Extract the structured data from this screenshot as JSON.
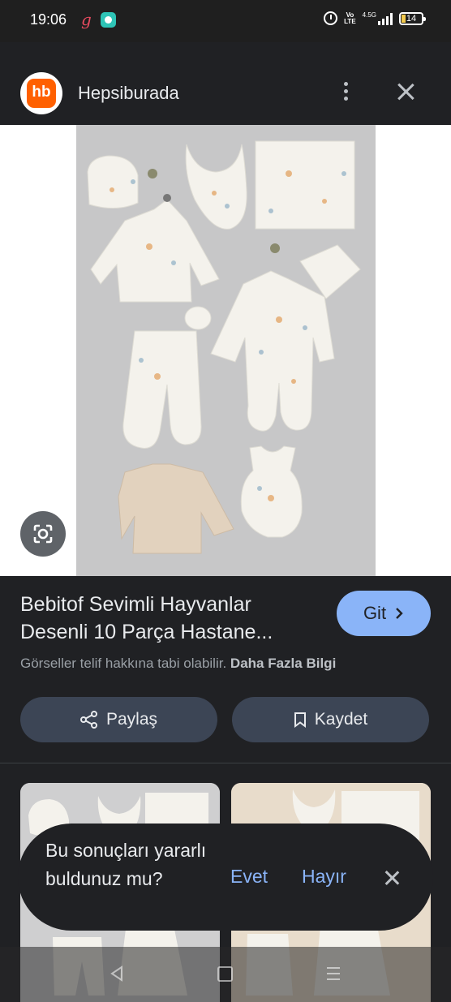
{
  "status_bar": {
    "time": "19:06",
    "network": "4.5G",
    "volte": "Vo LTE",
    "battery": "14"
  },
  "header": {
    "logo_text": "hb",
    "site_name": "Hepsiburada"
  },
  "product": {
    "title_line1": "Bebitof Sevimli Hayvanlar",
    "title_line2": "Desenli 10 Parça Hastane...",
    "visit_label": "Git",
    "copyright_text": "Görseller telif hakkına tabi olabilir.",
    "learn_more": "Daha Fazla Bilgi"
  },
  "actions": {
    "share_label": "Paylaş",
    "save_label": "Kaydet"
  },
  "feedback": {
    "question": "Bu sonuçları yararlı buldunuz mu?",
    "yes_label": "Evet",
    "no_label": "Hayır"
  },
  "colors": {
    "accent": "#8ab4f8",
    "brand": "#ff6000",
    "background": "#202124",
    "button": "#3c4555"
  },
  "icons": {
    "more": "more-vert-icon",
    "close": "close-icon",
    "lens": "google-lens-icon",
    "share": "share-icon",
    "save": "bookmark-icon",
    "chevron": "chevron-right-icon"
  }
}
